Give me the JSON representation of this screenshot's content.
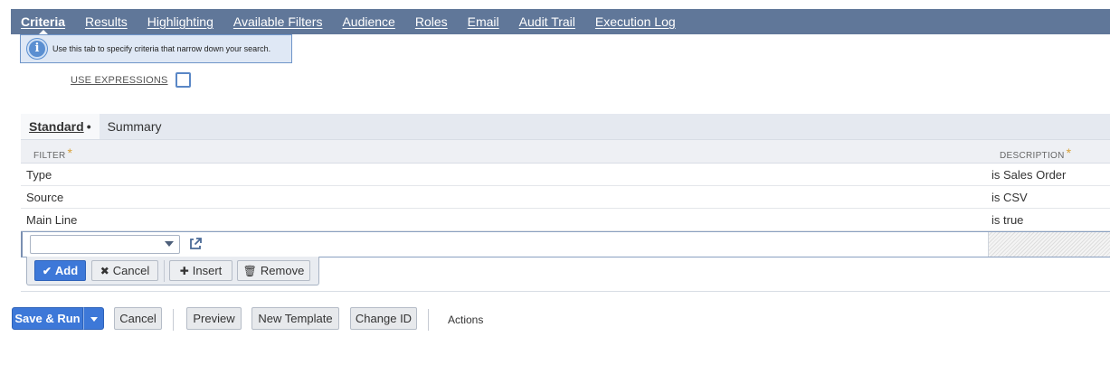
{
  "tabs": [
    {
      "label": "Criteria",
      "active": true
    },
    {
      "label": "Results",
      "active": false
    },
    {
      "label": "Highlighting",
      "active": false
    },
    {
      "label": "Available Filters",
      "active": false
    },
    {
      "label": "Audience",
      "active": false
    },
    {
      "label": "Roles",
      "active": false
    },
    {
      "label": "Email",
      "active": false
    },
    {
      "label": "Audit Trail",
      "active": false
    },
    {
      "label": "Execution Log",
      "active": false
    }
  ],
  "tooltip": {
    "text": "Use this tab to specify criteria that narrow down your search.",
    "icon": "info-icon"
  },
  "use_expressions": {
    "label": "USE EXPRESSIONS",
    "checked": false
  },
  "subtabs": {
    "standard": "Standard",
    "standard_marker": "•",
    "summary": "Summary"
  },
  "grid": {
    "filter_header": "FILTER",
    "description_header": "DESCRIPTION",
    "required_marker": "*",
    "rows": [
      {
        "filter": "Type",
        "description": "is Sales Order"
      },
      {
        "filter": "Source",
        "description": "is CSV"
      },
      {
        "filter": "Main Line",
        "description": "is true"
      }
    ],
    "new_filter_value": ""
  },
  "row_buttons": {
    "add": "Add",
    "cancel": "Cancel",
    "insert": "Insert",
    "remove": "Remove"
  },
  "footer": {
    "save_run": "Save & Run",
    "cancel": "Cancel",
    "preview": "Preview",
    "new_template": "New Template",
    "change_id": "Change ID",
    "actions": "Actions"
  },
  "colors": {
    "tab_bar": "#607799",
    "primary": "#3d78d8",
    "required": "#d8a13a"
  }
}
